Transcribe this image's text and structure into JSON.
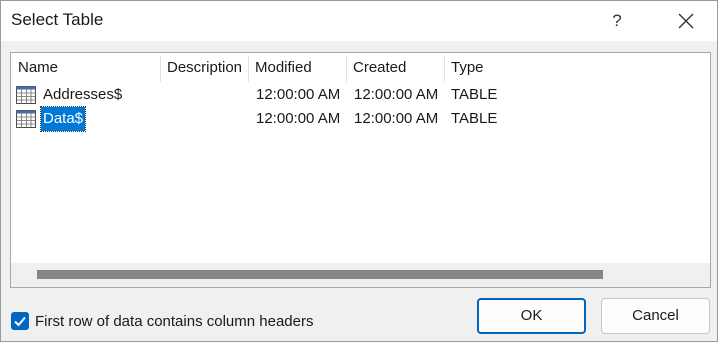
{
  "window": {
    "title": "Select Table",
    "help_label": "?"
  },
  "columns": [
    "Name",
    "Description",
    "Modified",
    "Created",
    "Type"
  ],
  "rows": [
    {
      "name": "Addresses$",
      "description": "",
      "modified": "12:00:00 AM",
      "created": "12:00:00 AM",
      "type": "TABLE",
      "selected": false
    },
    {
      "name": "Data$",
      "description": "",
      "modified": "12:00:00 AM",
      "created": "12:00:00 AM",
      "type": "TABLE",
      "selected": true
    }
  ],
  "options": {
    "first_row_headers_label": "First row of data contains column headers",
    "first_row_headers_checked": true
  },
  "buttons": {
    "ok_label": "OK",
    "cancel_label": "Cancel"
  },
  "colors": {
    "accent": "#0067c0",
    "selection": "#0078d7"
  }
}
